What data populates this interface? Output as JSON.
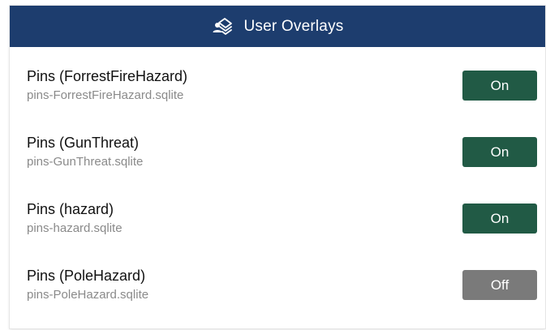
{
  "header": {
    "title": "User Overlays",
    "icon": "user-overlays-icon"
  },
  "colors": {
    "header_bg": "#1d3d6e",
    "toggle_on": "#215a45",
    "toggle_off": "#7a7a7a"
  },
  "overlays": [
    {
      "title": "Pins (ForrestFireHazard)",
      "file": "pins-ForrestFireHazard.sqlite",
      "toggle": "On"
    },
    {
      "title": "Pins (GunThreat)",
      "file": "pins-GunThreat.sqlite",
      "toggle": "On"
    },
    {
      "title": "Pins (hazard)",
      "file": "pins-hazard.sqlite",
      "toggle": "On"
    },
    {
      "title": "Pins (PoleHazard)",
      "file": "pins-PoleHazard.sqlite",
      "toggle": "Off"
    }
  ]
}
